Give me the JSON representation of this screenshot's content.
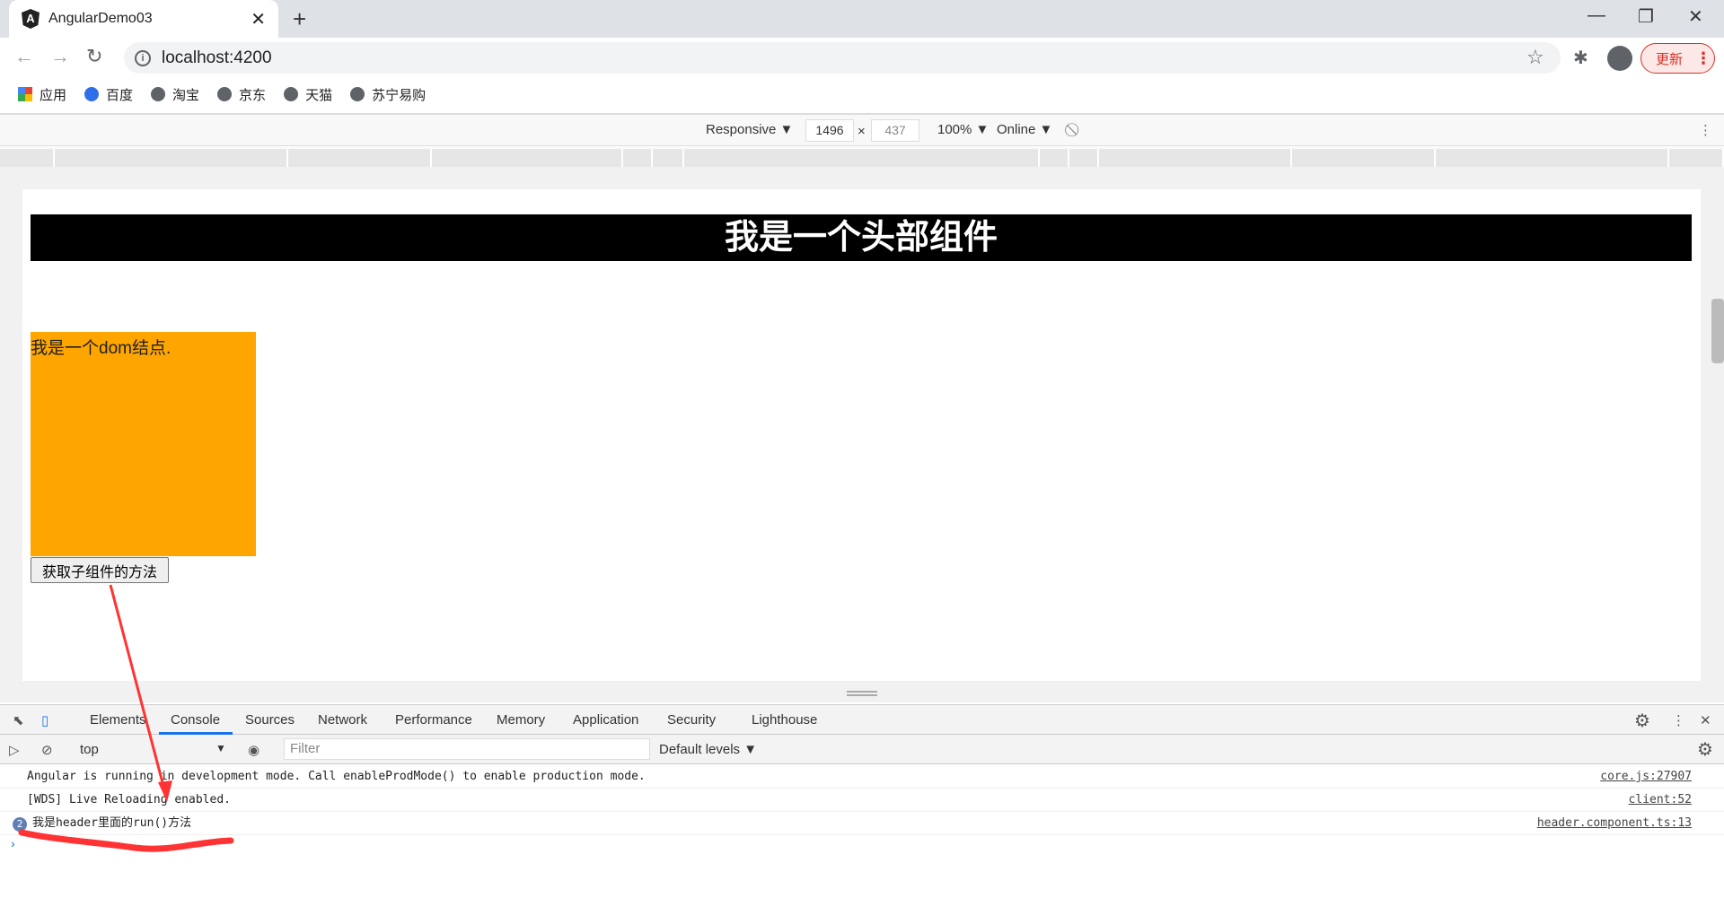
{
  "browser": {
    "tab_title": "AngularDemo03",
    "url": "localhost:4200",
    "update_label": "更新",
    "bookmarks": [
      {
        "label": "应用",
        "icon": "apps-icon"
      },
      {
        "label": "百度",
        "icon": "baidu-icon"
      },
      {
        "label": "淘宝",
        "icon": "globe-icon"
      },
      {
        "label": "京东",
        "icon": "globe-icon"
      },
      {
        "label": "天猫",
        "icon": "globe-icon"
      },
      {
        "label": "苏宁易购",
        "icon": "globe-icon"
      }
    ]
  },
  "device_toolbar": {
    "device": "Responsive ▼",
    "width": "1496",
    "times": "×",
    "height": "437",
    "zoom": "100% ▼",
    "network": "Online ▼"
  },
  "page": {
    "header": "我是一个头部组件",
    "box_text": "我是一个dom结点.",
    "button": "获取子组件的方法"
  },
  "devtools": {
    "tabs": [
      "Elements",
      "Console",
      "Sources",
      "Network",
      "Performance",
      "Memory",
      "Application",
      "Security",
      "Lighthouse"
    ],
    "active_tab": "Console",
    "context": "top",
    "filter_placeholder": "Filter",
    "levels": "Default levels ▼",
    "messages": [
      {
        "text": "Angular is running in development mode. Call enableProdMode() to enable production mode.",
        "source": "core.js:27907"
      },
      {
        "text": "[WDS] Live Reloading enabled.",
        "source": "client:52"
      },
      {
        "text": "我是header里面的run()方法",
        "source": "header.component.ts:13",
        "count": "2"
      }
    ]
  },
  "colors": {
    "accent": "#1a73e8",
    "box": "#ffa500",
    "annotation": "#ff3333"
  }
}
